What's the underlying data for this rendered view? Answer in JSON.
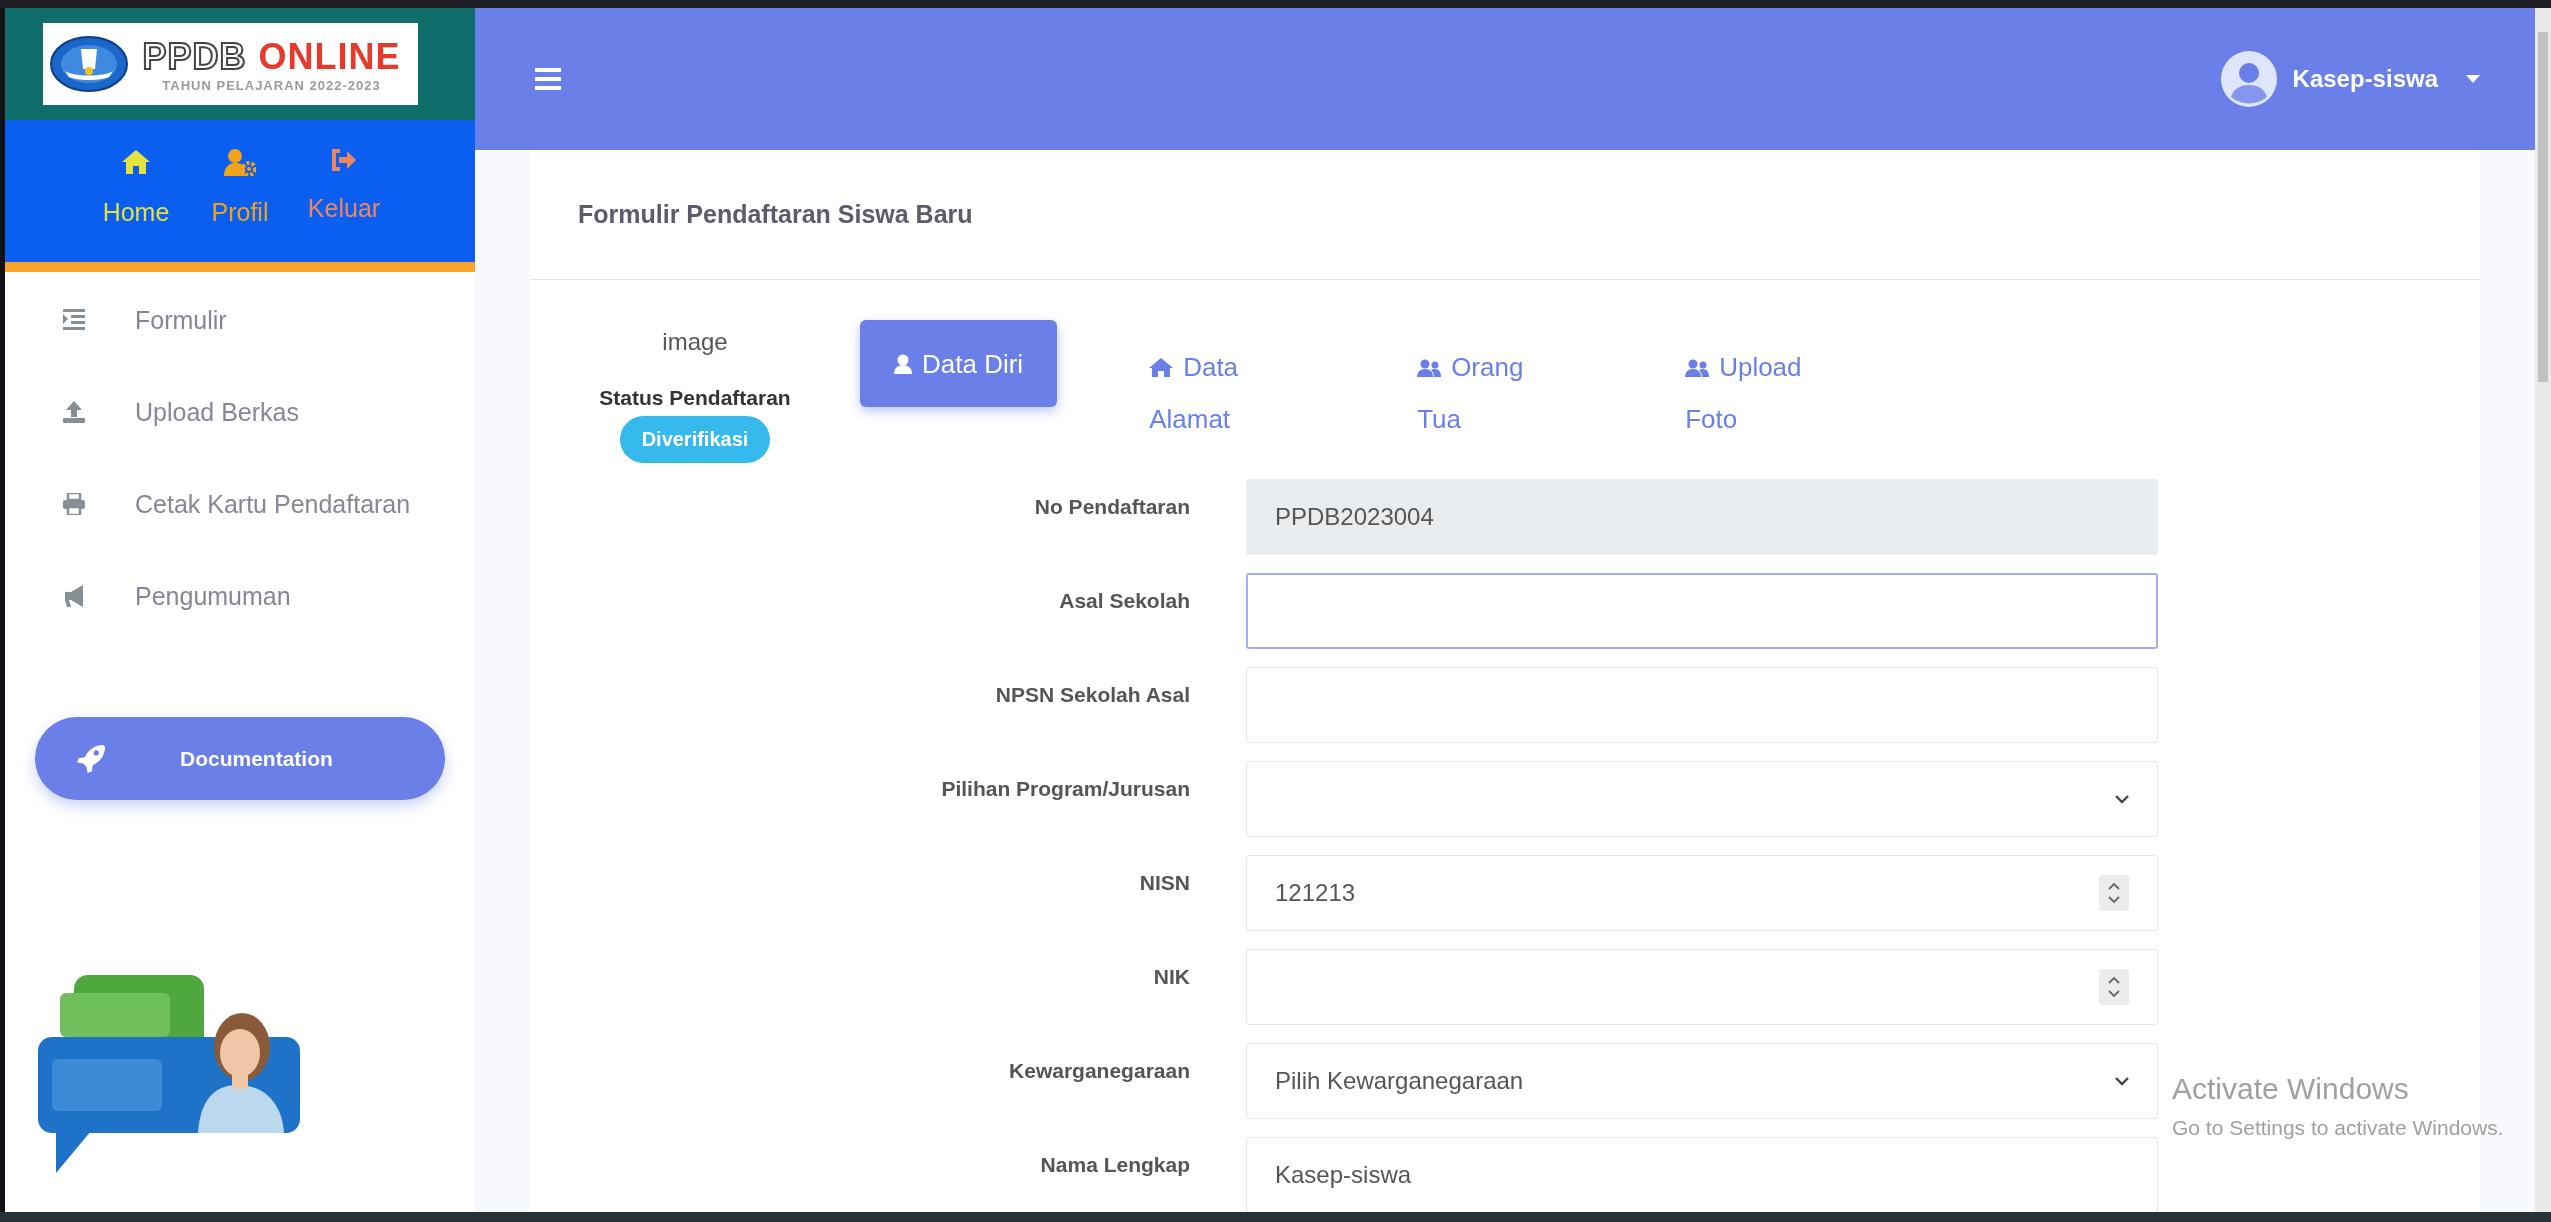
{
  "logo": {
    "title_part_1": "PPDB",
    "title_part_2": "ONLINE",
    "subtitle": "TAHUN PELAJARAN 2022-2023"
  },
  "nav_links": [
    {
      "label": "Home",
      "color": "#e4e23c"
    },
    {
      "label": "Profil",
      "color": "#f2a31c"
    },
    {
      "label": "Keluar",
      "color": "#ee8660"
    }
  ],
  "sidebar": {
    "items": [
      {
        "label": "Formulir"
      },
      {
        "label": "Upload Berkas"
      },
      {
        "label": "Cetak Kartu Pendaftaran"
      },
      {
        "label": "Pengumuman"
      }
    ],
    "documentation_button": "Documentation"
  },
  "header": {
    "user_name": "Kasep-siswa"
  },
  "card": {
    "title": "Formulir Pendaftaran Siswa Baru",
    "photo_alt_text": "image",
    "status_label": "Status Pendaftaran",
    "status_badge": "Diverifikasi",
    "tabs": [
      {
        "label": "Data Diri",
        "selected": true
      },
      {
        "label": "Data Alamat",
        "selected": false
      },
      {
        "label": "Orang Tua",
        "selected": false
      },
      {
        "label": "Upload Foto",
        "selected": false
      }
    ],
    "fields": [
      {
        "label": "No Pendaftaran",
        "kind": "text",
        "value": "PPDB2023004",
        "readonly": true,
        "focused": false
      },
      {
        "label": "Asal Sekolah",
        "kind": "text",
        "readonly": false,
        "focused": true
      },
      {
        "label": "NPSN Sekolah Asal",
        "kind": "text",
        "readonly": false,
        "focused": false
      },
      {
        "label": "Pilihan Program/Jurusan",
        "kind": "select",
        "readonly": false,
        "focused": false
      },
      {
        "label": "NISN",
        "kind": "number",
        "value": "121213",
        "readonly": false,
        "focused": false
      },
      {
        "label": "NIK",
        "kind": "number",
        "readonly": false,
        "focused": false
      },
      {
        "label": "Kewarganegaraan",
        "kind": "select",
        "value": "Pilih Kewarganegaraan",
        "readonly": false,
        "focused": false
      },
      {
        "label": "Nama Lengkap",
        "kind": "text",
        "value": "Kasep-siswa",
        "readonly": false,
        "focused": false
      }
    ]
  },
  "windows_notice": {
    "title": "Activate Windows",
    "subtitle": "Go to Settings to activate Windows."
  }
}
